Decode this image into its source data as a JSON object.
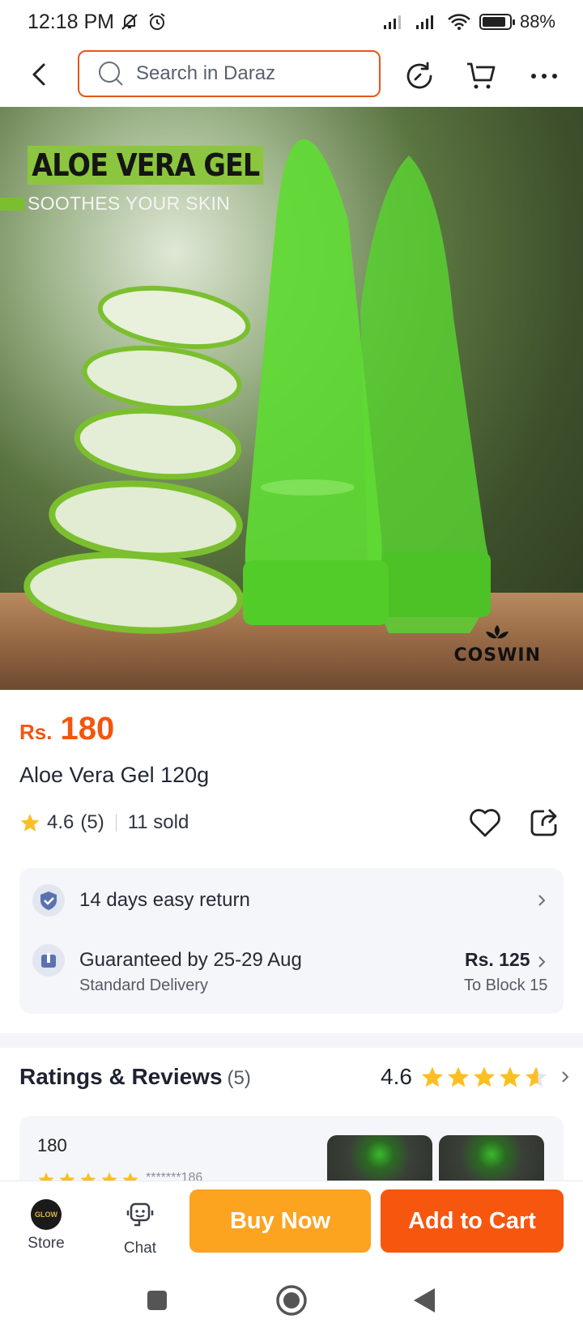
{
  "status_bar": {
    "time": "12:18 PM",
    "battery": "88%",
    "battery_level": 0.88
  },
  "search": {
    "placeholder": "Search in Daraz"
  },
  "hero": {
    "headline": "ALOE VERA GEL",
    "subhead": "SOOTHES YOUR SKIN",
    "brand": "COSWIN"
  },
  "product": {
    "currency": "Rs.",
    "price": "180",
    "title": "Aloe Vera Gel 120g",
    "rating": "4.6",
    "rating_count": "(5)",
    "sold": "11 sold"
  },
  "services": {
    "returns": "14 days easy return",
    "delivery": "Guaranteed by 25-29 Aug",
    "delivery_type": "Standard Delivery",
    "shipping_fee": "Rs. 125",
    "destination": "To Block 15"
  },
  "reviews": {
    "heading": "Ratings & Reviews",
    "count": "(5)",
    "score": "4.6",
    "score_value": 4.6,
    "first_review": {
      "name": "180",
      "user": "*******186",
      "stars": 5
    }
  },
  "bottom_bar": {
    "store": "Store",
    "chat": "Chat",
    "buy_now": "Buy Now",
    "add_to_cart": "Add to Cart",
    "store_logo": "GLOW"
  },
  "colors": {
    "accent": "#f7560f",
    "buy_now": "#fca320",
    "star": "#fcbf23"
  }
}
